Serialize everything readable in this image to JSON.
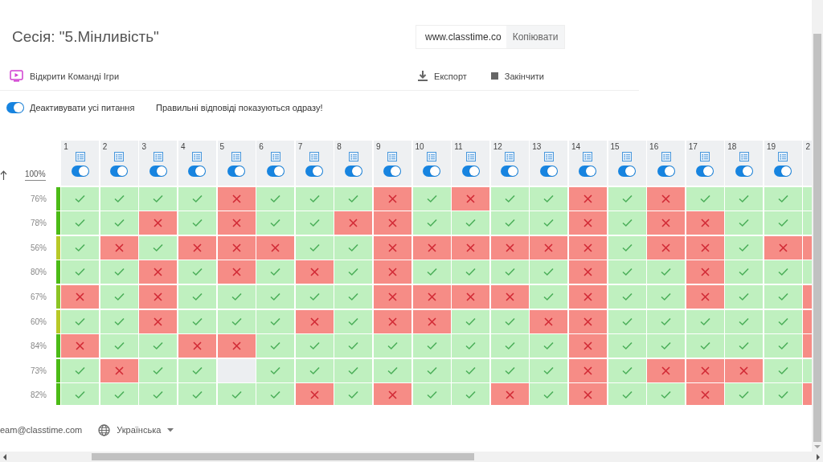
{
  "session_title": "Сесія: \"5.Мінливість\"",
  "share": {
    "url": "www.classtime.co",
    "copy_button": "Копіювати"
  },
  "toolbar": {
    "open_games": "Відкрити Команді Ігри",
    "export": "Експорт",
    "finish": "Закінчити"
  },
  "deactivate_all": {
    "label": "Деактивувати усі питання",
    "on": true
  },
  "notice": "Правильні відповіді показуються одразу!",
  "grid": {
    "total_label": "100%",
    "questions": [
      {
        "number": "1",
        "kind": "full",
        "active": true
      },
      {
        "number": "2",
        "kind": "full",
        "active": true
      },
      {
        "number": "3",
        "kind": "full",
        "active": true
      },
      {
        "number": "4",
        "kind": "full",
        "active": true
      },
      {
        "number": "5",
        "kind": "full",
        "active": true
      },
      {
        "number": "6",
        "kind": "full",
        "active": true
      },
      {
        "number": "7",
        "kind": "full",
        "active": true
      },
      {
        "number": "8",
        "kind": "full",
        "active": true
      },
      {
        "number": "9",
        "kind": "full",
        "active": true
      },
      {
        "number": "10",
        "kind": "full",
        "active": true
      },
      {
        "number": "11",
        "kind": "full",
        "active": true
      },
      {
        "number": "12",
        "kind": "full",
        "active": true
      },
      {
        "number": "13",
        "kind": "full",
        "active": true
      },
      {
        "number": "14",
        "kind": "full",
        "active": true
      },
      {
        "number": "15",
        "kind": "full",
        "active": true
      },
      {
        "number": "16",
        "kind": "full",
        "active": true
      },
      {
        "number": "17",
        "kind": "full",
        "active": true
      },
      {
        "number": "18",
        "kind": "full",
        "active": true
      },
      {
        "number": "19",
        "kind": "full",
        "active": true
      },
      {
        "number": "2",
        "kind": "partial"
      }
    ],
    "students": [
      {
        "score": "76%",
        "color": "#4cbb17",
        "answers": [
          {
            "kind": "correct"
          },
          {
            "kind": "correct"
          },
          {
            "kind": "correct"
          },
          {
            "kind": "correct"
          },
          {
            "kind": "wrong"
          },
          {
            "kind": "correct"
          },
          {
            "kind": "correct"
          },
          {
            "kind": "correct"
          },
          {
            "kind": "wrong"
          },
          {
            "kind": "correct"
          },
          {
            "kind": "wrong"
          },
          {
            "kind": "correct"
          },
          {
            "kind": "correct"
          },
          {
            "kind": "wrong"
          },
          {
            "kind": "correct"
          },
          {
            "kind": "wrong"
          },
          {
            "kind": "correct"
          },
          {
            "kind": "correct"
          },
          {
            "kind": "correct"
          },
          {
            "kind": "correct"
          }
        ]
      },
      {
        "score": "78%",
        "color": "#4cbb17",
        "answers": [
          {
            "kind": "correct"
          },
          {
            "kind": "correct"
          },
          {
            "kind": "wrong"
          },
          {
            "kind": "correct"
          },
          {
            "kind": "wrong"
          },
          {
            "kind": "correct"
          },
          {
            "kind": "correct"
          },
          {
            "kind": "wrong"
          },
          {
            "kind": "wrong"
          },
          {
            "kind": "correct"
          },
          {
            "kind": "correct"
          },
          {
            "kind": "correct"
          },
          {
            "kind": "correct"
          },
          {
            "kind": "wrong"
          },
          {
            "kind": "correct"
          },
          {
            "kind": "wrong"
          },
          {
            "kind": "wrong"
          },
          {
            "kind": "correct"
          },
          {
            "kind": "correct"
          },
          {
            "kind": "correct"
          }
        ]
      },
      {
        "score": "56%",
        "color": "#b8c928",
        "answers": [
          {
            "kind": "correct"
          },
          {
            "kind": "wrong"
          },
          {
            "kind": "correct"
          },
          {
            "kind": "wrong"
          },
          {
            "kind": "wrong"
          },
          {
            "kind": "wrong"
          },
          {
            "kind": "correct"
          },
          {
            "kind": "correct"
          },
          {
            "kind": "wrong"
          },
          {
            "kind": "wrong"
          },
          {
            "kind": "wrong"
          },
          {
            "kind": "wrong"
          },
          {
            "kind": "wrong"
          },
          {
            "kind": "wrong"
          },
          {
            "kind": "correct"
          },
          {
            "kind": "wrong"
          },
          {
            "kind": "wrong"
          },
          {
            "kind": "correct"
          },
          {
            "kind": "wrong"
          },
          {
            "kind": "wrong"
          }
        ]
      },
      {
        "score": "80%",
        "color": "#4cbb17",
        "answers": [
          {
            "kind": "correct"
          },
          {
            "kind": "correct"
          },
          {
            "kind": "wrong"
          },
          {
            "kind": "correct"
          },
          {
            "kind": "wrong"
          },
          {
            "kind": "correct"
          },
          {
            "kind": "wrong"
          },
          {
            "kind": "correct"
          },
          {
            "kind": "wrong"
          },
          {
            "kind": "correct"
          },
          {
            "kind": "correct"
          },
          {
            "kind": "correct"
          },
          {
            "kind": "correct"
          },
          {
            "kind": "wrong"
          },
          {
            "kind": "correct"
          },
          {
            "kind": "correct"
          },
          {
            "kind": "wrong"
          },
          {
            "kind": "correct"
          },
          {
            "kind": "correct"
          },
          {
            "kind": "correct"
          }
        ]
      },
      {
        "score": "67%",
        "color": "#8cc425",
        "answers": [
          {
            "kind": "wrong"
          },
          {
            "kind": "correct"
          },
          {
            "kind": "wrong"
          },
          {
            "kind": "correct"
          },
          {
            "kind": "correct"
          },
          {
            "kind": "correct"
          },
          {
            "kind": "correct"
          },
          {
            "kind": "correct"
          },
          {
            "kind": "wrong"
          },
          {
            "kind": "wrong"
          },
          {
            "kind": "wrong"
          },
          {
            "kind": "wrong"
          },
          {
            "kind": "correct"
          },
          {
            "kind": "wrong"
          },
          {
            "kind": "correct"
          },
          {
            "kind": "correct"
          },
          {
            "kind": "wrong"
          },
          {
            "kind": "correct"
          },
          {
            "kind": "correct"
          },
          {
            "kind": "wrong"
          }
        ]
      },
      {
        "score": "60%",
        "color": "#b8c928",
        "answers": [
          {
            "kind": "correct"
          },
          {
            "kind": "correct"
          },
          {
            "kind": "wrong"
          },
          {
            "kind": "correct"
          },
          {
            "kind": "correct"
          },
          {
            "kind": "correct"
          },
          {
            "kind": "wrong"
          },
          {
            "kind": "correct"
          },
          {
            "kind": "wrong"
          },
          {
            "kind": "wrong"
          },
          {
            "kind": "correct"
          },
          {
            "kind": "correct"
          },
          {
            "kind": "wrong"
          },
          {
            "kind": "wrong"
          },
          {
            "kind": "correct"
          },
          {
            "kind": "correct"
          },
          {
            "kind": "correct"
          },
          {
            "kind": "correct"
          },
          {
            "kind": "correct"
          },
          {
            "kind": "wrong"
          }
        ]
      },
      {
        "score": "84%",
        "color": "#4cbb17",
        "answers": [
          {
            "kind": "wrong"
          },
          {
            "kind": "correct"
          },
          {
            "kind": "correct"
          },
          {
            "kind": "wrong"
          },
          {
            "kind": "wrong"
          },
          {
            "kind": "correct"
          },
          {
            "kind": "correct"
          },
          {
            "kind": "correct"
          },
          {
            "kind": "correct"
          },
          {
            "kind": "correct"
          },
          {
            "kind": "correct"
          },
          {
            "kind": "correct"
          },
          {
            "kind": "correct"
          },
          {
            "kind": "wrong"
          },
          {
            "kind": "correct"
          },
          {
            "kind": "correct"
          },
          {
            "kind": "correct"
          },
          {
            "kind": "correct"
          },
          {
            "kind": "correct"
          },
          {
            "kind": "wrong"
          }
        ]
      },
      {
        "score": "73%",
        "color": "#4cbb17",
        "answers": [
          {
            "kind": "correct"
          },
          {
            "kind": "wrong"
          },
          {
            "kind": "correct"
          },
          {
            "kind": "correct"
          },
          {
            "kind": "empty"
          },
          {
            "kind": "correct"
          },
          {
            "kind": "correct"
          },
          {
            "kind": "correct"
          },
          {
            "kind": "correct"
          },
          {
            "kind": "correct"
          },
          {
            "kind": "correct"
          },
          {
            "kind": "correct"
          },
          {
            "kind": "correct"
          },
          {
            "kind": "wrong"
          },
          {
            "kind": "correct"
          },
          {
            "kind": "wrong"
          },
          {
            "kind": "wrong"
          },
          {
            "kind": "wrong"
          },
          {
            "kind": "correct"
          },
          {
            "kind": "correct"
          }
        ]
      },
      {
        "score": "82%",
        "color": "#4cbb17",
        "answers": [
          {
            "kind": "correct"
          },
          {
            "kind": "correct"
          },
          {
            "kind": "correct"
          },
          {
            "kind": "correct"
          },
          {
            "kind": "correct"
          },
          {
            "kind": "correct"
          },
          {
            "kind": "wrong"
          },
          {
            "kind": "correct"
          },
          {
            "kind": "wrong"
          },
          {
            "kind": "correct"
          },
          {
            "kind": "correct"
          },
          {
            "kind": "wrong"
          },
          {
            "kind": "correct"
          },
          {
            "kind": "wrong"
          },
          {
            "kind": "correct"
          },
          {
            "kind": "correct"
          },
          {
            "kind": "wrong"
          },
          {
            "kind": "correct"
          },
          {
            "kind": "correct"
          },
          {
            "kind": "wrong"
          }
        ]
      }
    ]
  },
  "footer": {
    "email": "eam@classtime.com",
    "language": "Українська"
  }
}
